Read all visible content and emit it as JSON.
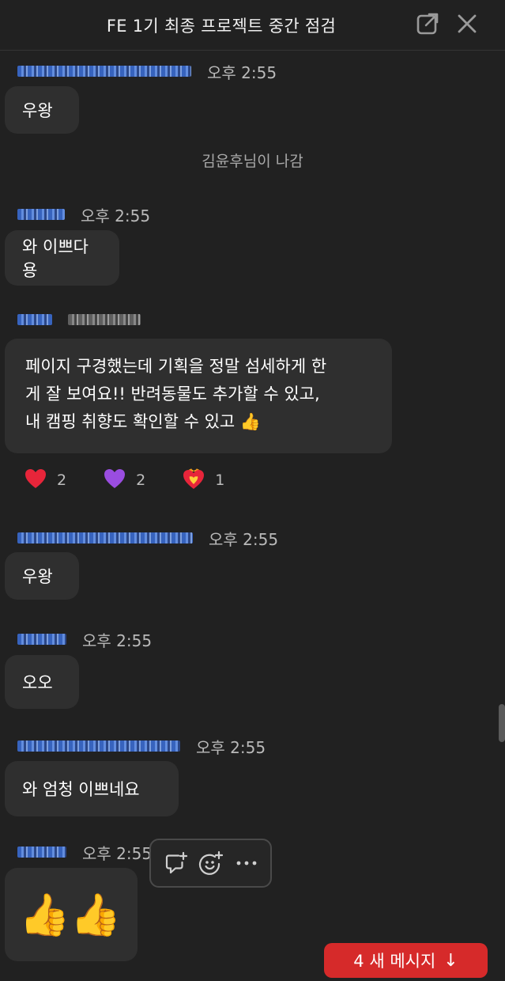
{
  "header": {
    "title": "FE 1기 최종 프로젝트 중간 점검",
    "icons": [
      "external-link-icon",
      "close-icon"
    ]
  },
  "messages": [
    {
      "time": "오후 2:55",
      "text": "우왕"
    },
    {
      "system": "김윤후님이 나감"
    },
    {
      "time": "오후 2:55",
      "text": "와 이쁘다용"
    },
    {
      "time": "",
      "lines": [
        "페이지 구경했는데 기획을 정말 섬세하게 한",
        "게 잘 보여요!! 반려동물도 추가할 수 있고,",
        "내 캠핑 취향도 확인할 수 있고 👍"
      ]
    },
    {
      "time": "오후 2:55",
      "text": "우왕"
    },
    {
      "time": "오후 2:55",
      "text": "오오"
    },
    {
      "time": "오후 2:55",
      "text": "와 엄청 이쁘네요"
    },
    {
      "time": "오후 2:55",
      "text": "👍👍"
    }
  ],
  "reactions": [
    {
      "emoji": "❤️",
      "icon": "red-heart-icon",
      "count": "2"
    },
    {
      "emoji": "💜",
      "icon": "purple-heart-icon",
      "count": "2"
    },
    {
      "emoji": "❤️‍🔥",
      "icon": "heart-on-fire-icon",
      "count": "1"
    }
  ],
  "action_icons": [
    "reply-icon",
    "add-reaction-icon",
    "more-icon"
  ],
  "new_messages": {
    "label": "4 새 메시지",
    "icon": "arrow-down-icon"
  },
  "colors": {
    "background": "#212121",
    "bubble": "#2f2f2f",
    "accent": "#d62a2a",
    "name": "#6ea0ff"
  }
}
